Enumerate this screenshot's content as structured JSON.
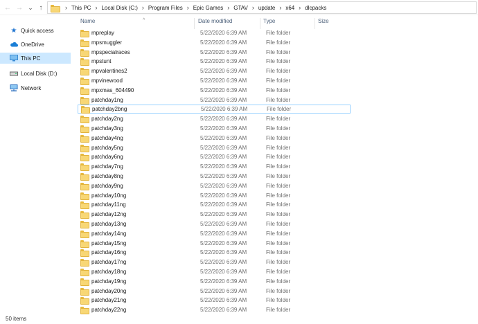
{
  "address": {
    "crumbs": [
      "This PC",
      "Local Disk (C:)",
      "Program Files",
      "Epic Games",
      "GTAV",
      "update",
      "x64",
      "dlcpacks"
    ]
  },
  "nav": {
    "back_glyph": "←",
    "forward_glyph": "→",
    "recent_glyph": "⌄",
    "up_glyph": "↑"
  },
  "sidebar": {
    "items": [
      {
        "label": "Quick access",
        "icon": "star-icon",
        "color": "#1f74d0"
      },
      {
        "label": "OneDrive",
        "icon": "cloud-icon",
        "color": "#1b7fd6"
      },
      {
        "label": "This PC",
        "icon": "computer-icon",
        "color": "#3b8bd4",
        "selected": true
      },
      {
        "label": "Local Disk (D:)",
        "icon": "drive-icon",
        "color": "#555555"
      },
      {
        "label": "Network",
        "icon": "network-icon",
        "color": "#2c6fbf"
      }
    ]
  },
  "columns": {
    "name": "Name",
    "date": "Date modified",
    "type": "Type",
    "size": "Size"
  },
  "files": [
    {
      "name": "mpreplay",
      "date": "5/22/2020 6:39 AM",
      "type": "File folder"
    },
    {
      "name": "mpsmuggler",
      "date": "5/22/2020 6:39 AM",
      "type": "File folder"
    },
    {
      "name": "mpspecialraces",
      "date": "5/22/2020 6:39 AM",
      "type": "File folder"
    },
    {
      "name": "mpstunt",
      "date": "5/22/2020 6:39 AM",
      "type": "File folder"
    },
    {
      "name": "mpvalentines2",
      "date": "5/22/2020 6:39 AM",
      "type": "File folder"
    },
    {
      "name": "mpvinewood",
      "date": "5/22/2020 6:39 AM",
      "type": "File folder"
    },
    {
      "name": "mpxmas_604490",
      "date": "5/22/2020 6:39 AM",
      "type": "File folder"
    },
    {
      "name": "patchday1ng",
      "date": "5/22/2020 6:39 AM",
      "type": "File folder"
    },
    {
      "name": "patchday2bng",
      "date": "5/22/2020 6:39 AM",
      "type": "File folder",
      "focused": true
    },
    {
      "name": "patchday2ng",
      "date": "5/22/2020 6:39 AM",
      "type": "File folder"
    },
    {
      "name": "patchday3ng",
      "date": "5/22/2020 6:39 AM",
      "type": "File folder"
    },
    {
      "name": "patchday4ng",
      "date": "5/22/2020 6:39 AM",
      "type": "File folder"
    },
    {
      "name": "patchday5ng",
      "date": "5/22/2020 6:39 AM",
      "type": "File folder"
    },
    {
      "name": "patchday6ng",
      "date": "5/22/2020 6:39 AM",
      "type": "File folder"
    },
    {
      "name": "patchday7ng",
      "date": "5/22/2020 6:39 AM",
      "type": "File folder"
    },
    {
      "name": "patchday8ng",
      "date": "5/22/2020 6:39 AM",
      "type": "File folder"
    },
    {
      "name": "patchday9ng",
      "date": "5/22/2020 6:39 AM",
      "type": "File folder"
    },
    {
      "name": "patchday10ng",
      "date": "5/22/2020 6:39 AM",
      "type": "File folder"
    },
    {
      "name": "patchday11ng",
      "date": "5/22/2020 6:39 AM",
      "type": "File folder"
    },
    {
      "name": "patchday12ng",
      "date": "5/22/2020 6:39 AM",
      "type": "File folder"
    },
    {
      "name": "patchday13ng",
      "date": "5/22/2020 6:39 AM",
      "type": "File folder"
    },
    {
      "name": "patchday14ng",
      "date": "5/22/2020 6:39 AM",
      "type": "File folder"
    },
    {
      "name": "patchday15ng",
      "date": "5/22/2020 6:39 AM",
      "type": "File folder"
    },
    {
      "name": "patchday16ng",
      "date": "5/22/2020 6:39 AM",
      "type": "File folder"
    },
    {
      "name": "patchday17ng",
      "date": "5/22/2020 6:39 AM",
      "type": "File folder"
    },
    {
      "name": "patchday18ng",
      "date": "5/22/2020 6:39 AM",
      "type": "File folder"
    },
    {
      "name": "patchday19ng",
      "date": "5/22/2020 6:39 AM",
      "type": "File folder"
    },
    {
      "name": "patchday20ng",
      "date": "5/22/2020 6:39 AM",
      "type": "File folder"
    },
    {
      "name": "patchday21ng",
      "date": "5/22/2020 6:39 AM",
      "type": "File folder"
    },
    {
      "name": "patchday22ng",
      "date": "5/22/2020 6:39 AM",
      "type": "File folder"
    }
  ],
  "status": {
    "count": "50 items"
  },
  "colors": {
    "selected_bg": "#cce8ff",
    "focus_border": "#99d1ff",
    "folder": "#f8d775"
  }
}
